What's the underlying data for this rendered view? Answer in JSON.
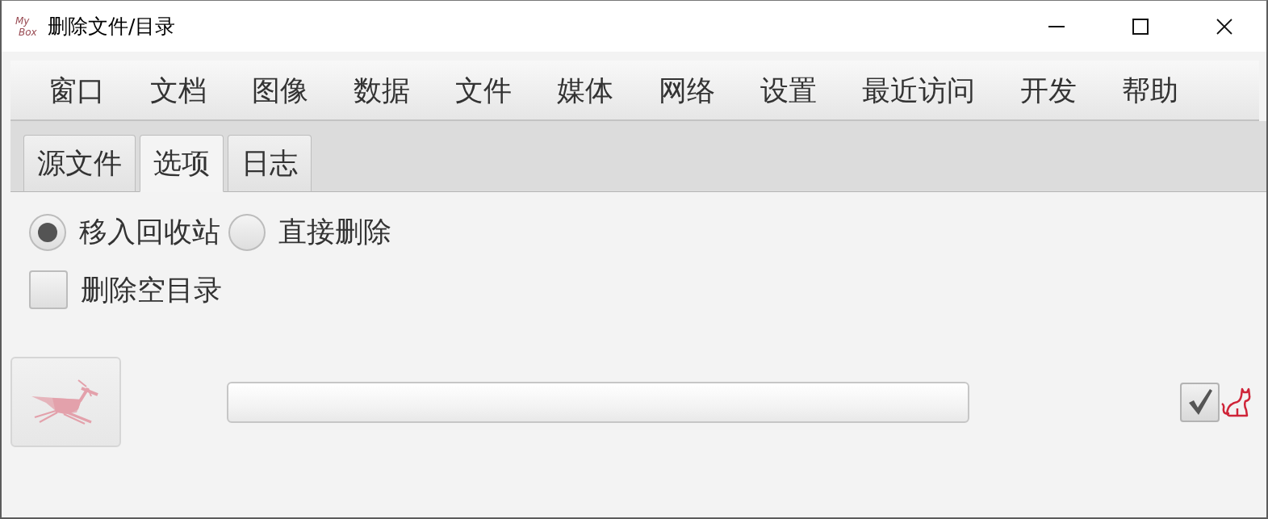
{
  "window": {
    "logo": [
      "My",
      "Box"
    ],
    "title": "删除文件/目录"
  },
  "menu": [
    "窗口",
    "文档",
    "图像",
    "数据",
    "文件",
    "媒体",
    "网络",
    "设置",
    "最近访问",
    "开发",
    "帮助"
  ],
  "tabs": [
    {
      "label": "源文件",
      "selected": false
    },
    {
      "label": "选项",
      "selected": true
    },
    {
      "label": "日志",
      "selected": false
    }
  ],
  "options": {
    "delete_mode": [
      {
        "label": "移入回收站",
        "selected": true
      },
      {
        "label": "直接删除",
        "selected": false
      }
    ],
    "checkboxes": [
      {
        "label": "删除空目录",
        "checked": false
      }
    ]
  },
  "bottom_bar": {
    "checkbox": {
      "checked": true
    }
  }
}
